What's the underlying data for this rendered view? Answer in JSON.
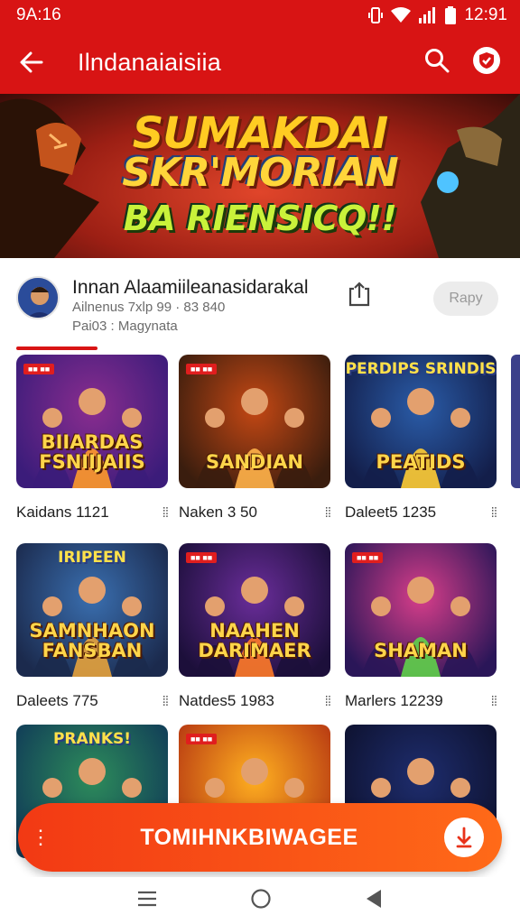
{
  "status": {
    "left": "9A:16",
    "time": "12:91"
  },
  "appbar": {
    "title": "Ilndanaiaisiia"
  },
  "banner": {
    "line1": "SUMAKDAI",
    "line2": "SKR'MORIAN",
    "line3": "BA RIENSICQ!!"
  },
  "channel": {
    "name": "Innan Alaamiileanasidarakal",
    "sub1": "Ailnenus 7xlp 99 · 83 840",
    "sub2": "Pai03 : Magynata",
    "follow_label": "Rapy"
  },
  "cards": [
    {
      "tag": "■■ ■■",
      "top": "",
      "art": "BIIARDAS FSNIIJAIIS",
      "label": "Kaidans 1121",
      "palette": [
        "#8a2d8f",
        "#3b1c7a",
        "#ff9a2a"
      ]
    },
    {
      "tag": "■■ ■■",
      "top": "",
      "art": "SANDIAN",
      "label": "Naken 3 50",
      "palette": [
        "#c54814",
        "#3a1d0e",
        "#ffb24a"
      ]
    },
    {
      "tag": "",
      "top": "PERDIPS SRINDIS",
      "art": "PEATIDS",
      "label": "Daleet5 1235",
      "palette": [
        "#2a5ca8",
        "#131e4a",
        "#ffcc33"
      ]
    },
    {
      "tag": "",
      "top": "IRIPEEN",
      "art": "SAMNHAON FANSBAN",
      "label": "Daleets 775",
      "palette": [
        "#3a6fb0",
        "#1b2a4d",
        "#e6a23c"
      ]
    },
    {
      "tag": "■■ ■■",
      "top": "",
      "art": "NAAHEN DARIMAER",
      "label": "Natdes5 1983",
      "palette": [
        "#6a2d9a",
        "#1c0f3a",
        "#ff7a28"
      ]
    },
    {
      "tag": "■■ ■■",
      "top": "",
      "art": "SHAMAN",
      "label": "Marlers 12239",
      "palette": [
        "#d83e8a",
        "#2a1658",
        "#5fd04a"
      ]
    },
    {
      "tag": "",
      "top": "PRANKS!",
      "art": "",
      "label": "",
      "palette": [
        "#2d8c5a",
        "#113d58",
        "#ffd54a"
      ]
    },
    {
      "tag": "■■ ■■",
      "top": "",
      "art": "",
      "label": "",
      "palette": [
        "#ffb020",
        "#b83a12",
        "#ffe07a"
      ]
    },
    {
      "tag": "",
      "top": "",
      "art": "",
      "label": "",
      "palette": [
        "#1e2d6e",
        "#0e1230",
        "#ff6a28"
      ]
    }
  ],
  "cta": {
    "label": "TOMIHNKBIWAGEE"
  },
  "colors": {
    "primary": "#d81414",
    "cta_start": "#f23914",
    "cta_end": "#ff6a18"
  }
}
